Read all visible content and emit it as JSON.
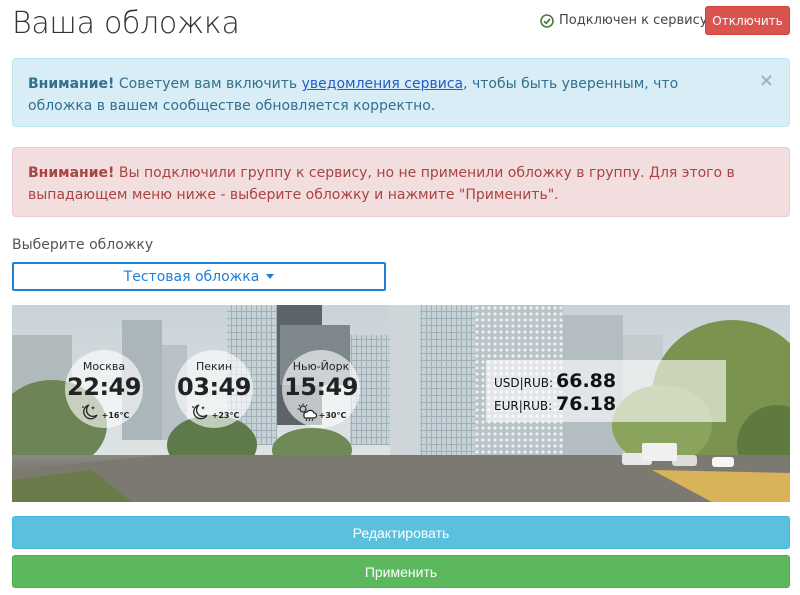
{
  "header": {
    "title": "Ваша обложка",
    "status": "Подключен к сервису",
    "disconnect_label": "Отключить"
  },
  "info_alert": {
    "strong": "Внимание!",
    "text_before": " Советуем вам включить ",
    "link": "уведомления сервиса",
    "text_after": ", чтобы быть уверенным, что обложка в вашем сообществе обновляется корректно.",
    "close": "×"
  },
  "danger_alert": {
    "strong": "Внимание!",
    "text": " Вы подключили группу к сервису, но не применили обложку в группу. Для этого в выпадающем меню ниже - выберите обложку и нажмите \"Применить\"."
  },
  "select": {
    "label": "Выберите обложку",
    "value": "Тестовая обложка"
  },
  "cover": {
    "clocks": [
      {
        "city": "Москва",
        "time": "22:49",
        "temp": "+16°C",
        "weather": "night-clear"
      },
      {
        "city": "Пекин",
        "time": "03:49",
        "temp": "+23°C",
        "weather": "night-clear"
      },
      {
        "city": "Нью-Йорк",
        "time": "15:49",
        "temp": "+30°C",
        "weather": "sun-cloud-rain"
      }
    ],
    "rates": [
      {
        "label": "USD|RUB:",
        "value": "66.88"
      },
      {
        "label": "EUR|RUB:",
        "value": "76.18"
      }
    ]
  },
  "actions": {
    "edit_label": "Редактировать",
    "apply_label": "Применить"
  },
  "colors": {
    "danger": "#d9534f",
    "info_bg": "#d9edf7",
    "danger_bg": "#f2dede",
    "select_accent": "#1e7fd9",
    "edit": "#5bc0de",
    "apply": "#5cb85c"
  }
}
